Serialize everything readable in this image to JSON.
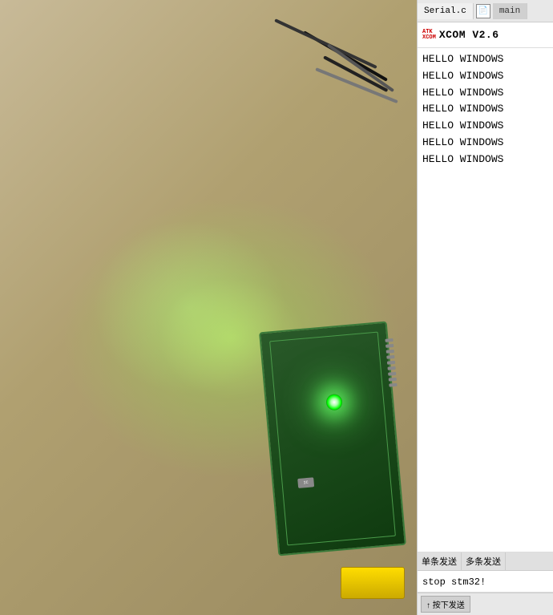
{
  "tabs": {
    "serial": "Serial.c",
    "file_icon": "📄",
    "main": "main"
  },
  "header": {
    "logo_top": "ATK",
    "logo_bottom": "XCOM",
    "title": "XCOM V2.6"
  },
  "serial_output": {
    "lines": [
      "HELLO WINDOWS",
      "HELLO WINDOWS",
      "HELLO WINDOWS",
      "HELLO WINDOWS",
      "HELLO WINDOWS",
      "HELLO WINDOWS",
      "HELLO WINDOWS"
    ]
  },
  "send_tabs": {
    "single": "单条发送",
    "multi": "多条发送"
  },
  "send_input": {
    "value": "stop stm32!",
    "placeholder": ""
  },
  "bottom_toolbar": {
    "send_button": "↑ 按下发送",
    "label": ""
  },
  "colors": {
    "accent_red": "#cc0000",
    "bg_white": "#ffffff",
    "bg_panel": "#f0f0f0"
  }
}
